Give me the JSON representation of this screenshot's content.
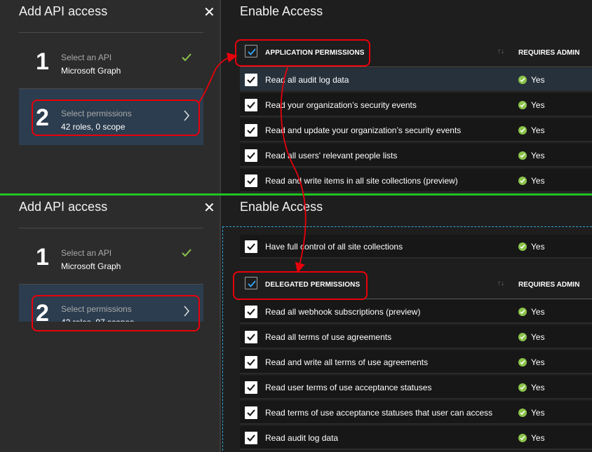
{
  "colors": {
    "accent_check": "#8bc34a",
    "selected_step_bg": "#2b3d4f",
    "annotation_red": "#e8000b",
    "divider_green": "#21c521",
    "dashed_focus": "#2fa8d8"
  },
  "icons": {
    "close": "close-icon",
    "step_complete": "checkmark-icon",
    "step_next": "chevron-right-icon",
    "row_checkbox": "checkbox-checked-icon",
    "requires_admin": "green-check-circle-icon",
    "sort": "sort-arrows-icon"
  },
  "top": {
    "blade_title": "Add API access",
    "close": "✕",
    "steps": [
      {
        "number": "1",
        "label": "Select an API",
        "value": "Microsoft Graph"
      },
      {
        "number": "2",
        "label": "Select permissions",
        "value": "42 roles, 0 scope"
      }
    ],
    "right_title": "Enable Access",
    "section_header": "APPLICATION PERMISSIONS",
    "sort": "↑↓",
    "requires_admin": "REQUIRES ADMIN",
    "rows": [
      {
        "label": "Read all audit log data",
        "admin": "Yes"
      },
      {
        "label": "Read your organization’s security events",
        "admin": "Yes"
      },
      {
        "label": "Read and update your organization’s security events",
        "admin": "Yes"
      },
      {
        "label": "Read all users' relevant people lists",
        "admin": "Yes"
      },
      {
        "label": "Read and write items in all site collections (preview)",
        "admin": "Yes"
      }
    ]
  },
  "bottom": {
    "blade_title": "Add API access",
    "close": "✕",
    "steps": [
      {
        "number": "1",
        "label": "Select an API",
        "value": "Microsoft Graph"
      },
      {
        "number": "2",
        "label": "Select permissions",
        "value": "42 roles, 97 scopes"
      }
    ],
    "right_title": "Enable Access",
    "first_row": {
      "label": "Have full control of all site collections",
      "admin": "Yes"
    },
    "section_header": "DELEGATED PERMISSIONS",
    "sort": "↑↓",
    "requires_admin": "REQUIRES ADMIN",
    "rows": [
      {
        "label": "Read all webhook subscriptions (preview)",
        "admin": "Yes"
      },
      {
        "label": "Read all terms of use agreements",
        "admin": "Yes"
      },
      {
        "label": "Read and write all terms of use agreements",
        "admin": "Yes"
      },
      {
        "label": "Read user terms of use acceptance statuses",
        "admin": "Yes"
      },
      {
        "label": "Read terms of use acceptance statuses that user can access",
        "admin": "Yes"
      },
      {
        "label": "Read audit log data",
        "admin": "Yes"
      }
    ]
  }
}
